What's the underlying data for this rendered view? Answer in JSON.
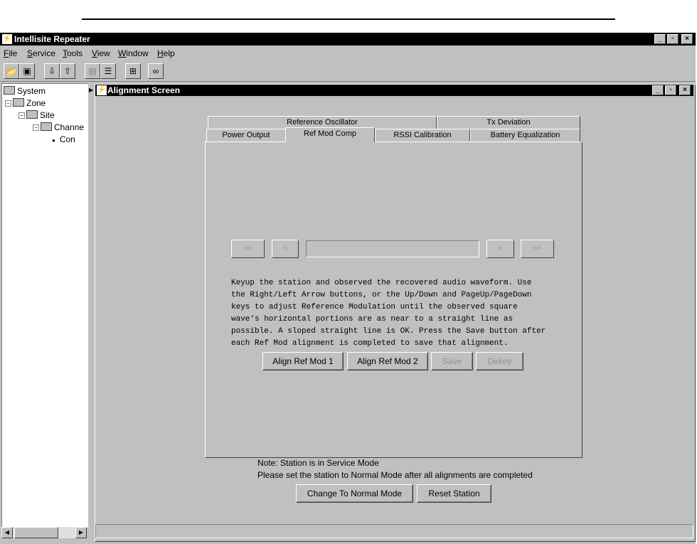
{
  "app": {
    "title": "Intellisite Repeater",
    "window_buttons": [
      "_",
      "▫",
      "×"
    ]
  },
  "menu": [
    "File",
    "Service",
    "Tools",
    "View",
    "Window",
    "Help"
  ],
  "toolbar": {
    "icons": [
      "open-folder-icon",
      "save-disk-icon",
      "download-icon",
      "upload-icon",
      "briefcase-icon",
      "document-icon",
      "network-icon",
      "binoculars-icon"
    ]
  },
  "tree": {
    "items": [
      {
        "label": "System",
        "icon": "folder-icon"
      },
      {
        "label": "Zone",
        "icon": "folder-icon"
      },
      {
        "label": "Site",
        "icon": "folder-icon"
      },
      {
        "label": "Channe",
        "icon": "folder-icon"
      },
      {
        "label": "Con",
        "icon": "bullet-icon"
      }
    ]
  },
  "alignment": {
    "title": "Alignment Screen",
    "tabs_back": [
      "Reference Oscillator",
      "Tx Deviation"
    ],
    "tabs_front": [
      "Power Output",
      "Ref Mod Comp",
      "RSSI Calibration",
      "Battery Equalization"
    ],
    "active_tab": "Ref Mod Comp",
    "nav": {
      "first": "<<",
      "prev": "<",
      "next": ">",
      "last": ">>"
    },
    "value_field": "",
    "instructions": "Keyup the station and observed the recovered audio waveform. Use\nthe Right/Left Arrow buttons, or the Up/Down and PageUp/PageDown\nkeys to adjust Reference Modulation until the observed square\nwave's horizontal portions are as near to a straight line as\npossible. A sloped straight line is OK. Press the Save button after\neach Ref Mod alignment is completed to save that alignment.",
    "buttons": {
      "align1": "Align Ref Mod 1",
      "align2": "Align Ref Mod 2",
      "save": "Save",
      "dekey": "Dekey"
    },
    "note_line1": "Note: Station is in Service Mode",
    "note_line2": "Please set the station to Normal Mode after all alignments are completed",
    "change_mode": "Change To Normal Mode",
    "reset": "Reset Station"
  }
}
